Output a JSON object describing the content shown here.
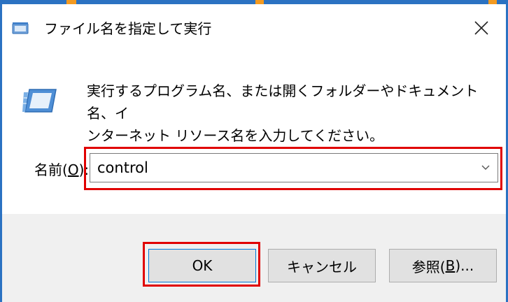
{
  "window": {
    "title": "ファイル名を指定して実行",
    "close_icon": "close-icon",
    "app_icon": "run-dialog-icon"
  },
  "description": {
    "line1": "実行するプログラム名、または開くフォルダーやドキュメント名、イ",
    "line2": "ンターネット リソース名を入力してください。"
  },
  "name_field": {
    "label_prefix": "名前(",
    "label_hotkey": "O",
    "label_suffix": "):",
    "value": "control",
    "dropdown_icon": "chevron-down-icon"
  },
  "buttons": {
    "ok": "OK",
    "cancel": "キャンセル",
    "browse_prefix": "参照(",
    "browse_hotkey": "B",
    "browse_suffix": ")..."
  },
  "colors": {
    "window_border": "#2b72c2",
    "highlight_outline": "#e00000",
    "dialog_bg": "#ffffff",
    "footer_bg": "#f0f0f0"
  }
}
